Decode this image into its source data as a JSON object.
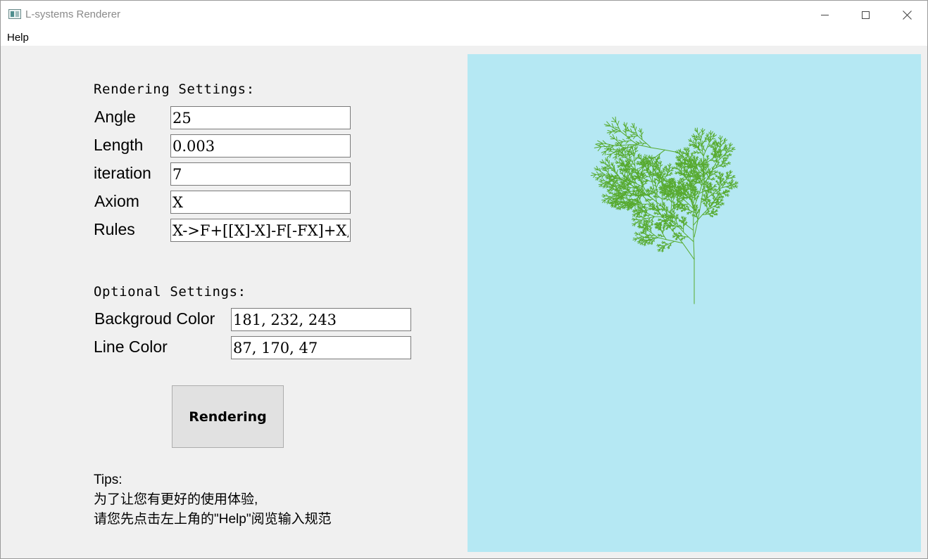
{
  "window": {
    "title": "L-systems Renderer",
    "icon": "app-window-icon"
  },
  "titlebar_buttons": {
    "minimize": "minimize-icon",
    "maximize": "maximize-icon",
    "close": "close-icon"
  },
  "menu": {
    "help": "Help"
  },
  "rendering_settings": {
    "heading": "Rendering Settings:",
    "angle_label": "Angle",
    "angle_value": "25",
    "length_label": "Length",
    "length_value": "0.003",
    "iteration_label": "iteration",
    "iteration_value": "7",
    "axiom_label": "Axiom",
    "axiom_value": "X",
    "rules_label": "Rules",
    "rules_value": "X->F+[[X]-X]-F[-FX]+X, F->FF"
  },
  "optional_settings": {
    "heading": "Optional Settings:",
    "background_label": "Backgroud Color",
    "background_value": "181, 232, 243",
    "line_label": "Line Color",
    "line_value": "87, 170, 47"
  },
  "render_button": "Rendering",
  "tips": {
    "title": "Tips:",
    "line1": "为了让您有更好的使用体验,",
    "line2": "请您先点击左上角的\"Help\"阅览输入规范"
  },
  "canvas": {
    "background": "#b5e8f3",
    "line_color": "#57aa2f"
  }
}
